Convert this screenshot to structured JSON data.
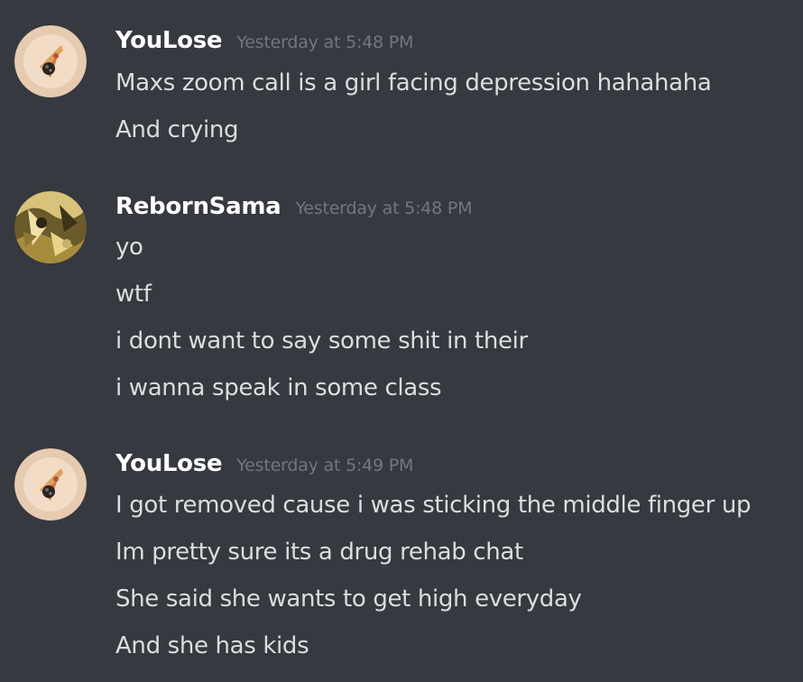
{
  "messages": [
    {
      "username": "YouLose",
      "timestamp": "Yesterday at 5:48 PM",
      "avatar_icon": "pizza-avatar-icon",
      "lines": [
        "Maxs zoom call is a girl facing depression hahahaha",
        "And crying"
      ]
    },
    {
      "username": "RebornSama",
      "timestamp": "Yesterday at 5:48 PM",
      "avatar_icon": "abstract-avatar-icon",
      "lines": [
        "yo",
        "wtf",
        "i dont want to say some shit in their",
        "i wanna speak in some class"
      ]
    },
    {
      "username": "YouLose",
      "timestamp": "Yesterday at 5:49 PM",
      "avatar_icon": "pizza-avatar-icon",
      "lines": [
        "I got removed cause i was sticking the middle finger up",
        "Im pretty sure its a drug rehab chat",
        "She said she wants to get high everyday",
        "And she has kids"
      ]
    }
  ],
  "colors": {
    "background": "#36393f",
    "username": "#ffffff",
    "timestamp": "#72767d",
    "message_text": "#dcddde"
  }
}
